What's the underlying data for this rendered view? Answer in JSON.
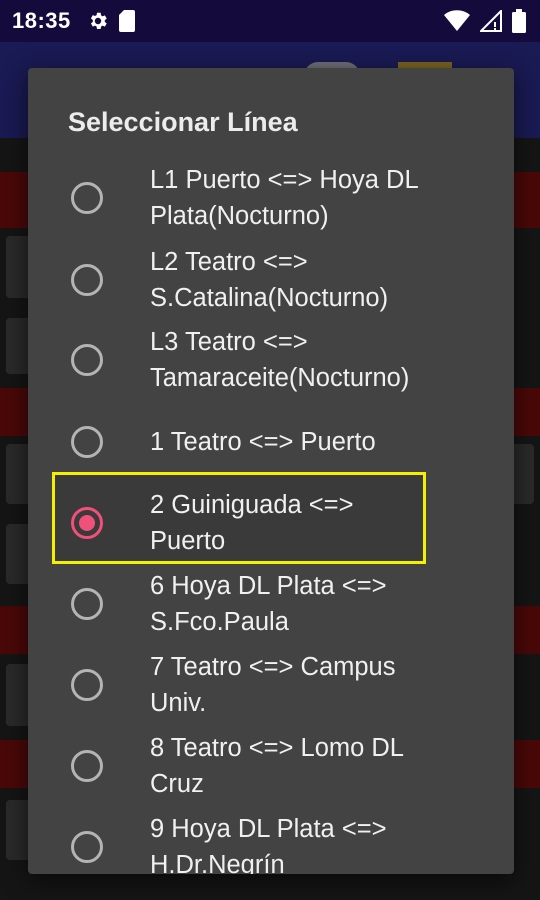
{
  "status_bar": {
    "time": "18:35",
    "icons": [
      "gear-icon",
      "sim-card-icon",
      "wifi-icon",
      "no-signal-icon",
      "battery-icon"
    ]
  },
  "dialog": {
    "title": "Seleccionar Línea",
    "selected_index": 4,
    "options": [
      {
        "label_line1": "L1  Puerto <=> Hoya DL",
        "label_line2": "Plata(Nocturno)",
        "selected": false
      },
      {
        "label_line1": "L2  Teatro <=>",
        "label_line2": "S.Catalina(Nocturno)",
        "selected": false
      },
      {
        "label_line1": "L3  Teatro <=>",
        "label_line2": "Tamaraceite(Nocturno)",
        "selected": false
      },
      {
        "label_line1": "1  Teatro <=> Puerto",
        "label_line2": "",
        "selected": false
      },
      {
        "label_line1": "2  Guiniguada <=>",
        "label_line2": "Puerto",
        "selected": true
      },
      {
        "label_line1": "6  Hoya DL Plata <=>",
        "label_line2": "S.Fco.Paula",
        "selected": false
      },
      {
        "label_line1": "7  Teatro <=> Campus",
        "label_line2": "Univ.",
        "selected": false
      },
      {
        "label_line1": "8  Teatro <=> Lomo DL",
        "label_line2": "Cruz",
        "selected": false
      },
      {
        "label_line1": "9  Hoya DL Plata <=>",
        "label_line2": "H.Dr.Negrín",
        "selected": false
      }
    ]
  },
  "colors": {
    "status_bar_bg": "#150a3c",
    "dialog_bg": "#434343",
    "radio_checked": "#f0507a",
    "highlight_border": "#f4f000"
  }
}
